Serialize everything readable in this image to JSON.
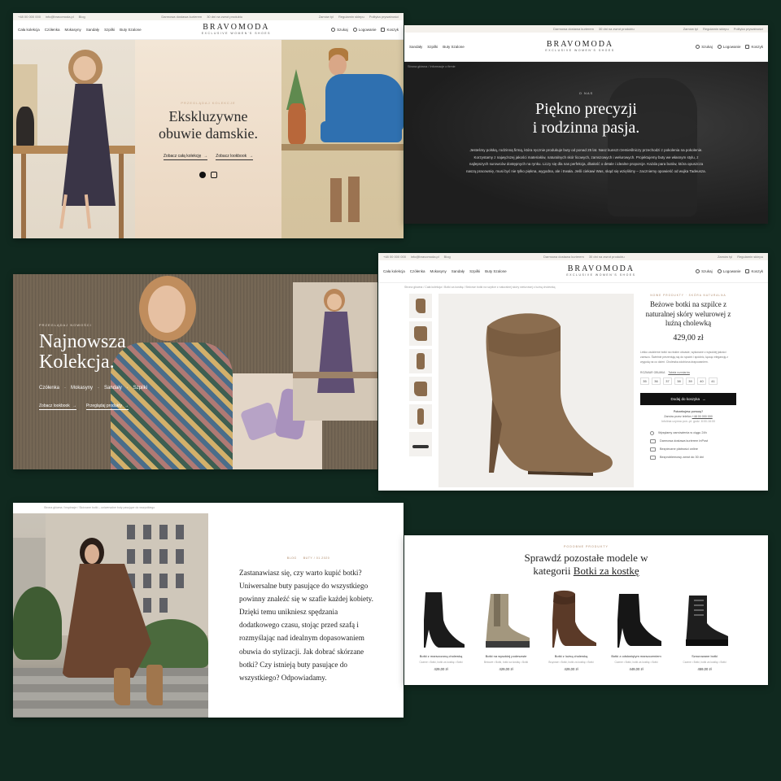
{
  "common": {
    "phone": "+48 00 000 000",
    "email": "info@bravomoda.pl",
    "blog": "Blog",
    "promo": "Darmowa dostawa kurierem",
    "promo_threshold": "30 dni na zwrot produktu",
    "account_links": [
      "Zamów tyl",
      "Regulamin sklepu",
      "Polityka prywatności"
    ],
    "nav": [
      "Cała kolekcja",
      "Czółenka",
      "Mokasyny",
      "Sandały",
      "Szpilki",
      "Buty Szalone"
    ],
    "brand": "BRAVOMODA",
    "brand_tag": "EXCLUSIVE WOMEN'S SHOES",
    "search": "Szukaj",
    "login": "Logowanie",
    "cart": "Koszyk"
  },
  "hero": {
    "eyebrow": "PRZEGLĄDAJ KOLEKCJE",
    "title_line1": "Ekskluzywne",
    "title_line2": "obuwie damskie.",
    "cta_collection": "Zobacz całą kolekcję",
    "cta_lookbook": "Zobacz lookbook"
  },
  "about": {
    "breadcrumb": "Strona główna / Informacje o firmie",
    "eyebrow": "O NAS",
    "title_line1": "Piękno precyzji",
    "title_line2": "i rodzinna pasja.",
    "paragraph": "Jesteśmy polską, rodzinną firmą, która ręcznie produkuje buty od ponad 25 lat. Nasz kunszt rzemieślniczy przechodzi z pokolenia na pokolenie. Korzystamy z najwyższej jakości materiałów, naturalnych skór licowych, zamszowych i welurowych. Projektujemy buty we własnym stylu, z najlepszych surowców dostępnych na rynku. Liczy się dla nas perfekcja, dbałość o detale i idealne proporcje. Każda para butów, która opuszcza naszą pracownię, musi być nie tylko piękna, wygodna, ale i trwała. Jeśli ciekawi Was, skąd się wzięliśmy – zaczniemy opowieść od wujka Tadeusza."
  },
  "collection": {
    "eyebrow": "PRZEGLĄDAJ NOWOŚCI",
    "title_line1": "Najnowsza",
    "title_line2": "Kolekcja.",
    "categories": [
      "Czółenka",
      "Mokasyny",
      "Sandały",
      "Szpilki"
    ],
    "cta_lookbook": "Zobacz lookbook",
    "cta_products": "Przeglądaj produkty"
  },
  "product": {
    "breadcrumb": "Strona główna / Cała kolekcja / Botki za kostkę / Beżowe botki na szpilce z naturalnej skóry welurowej z luźną cholewką",
    "eyebrow": "NOWE PRODUKTY  ·  SKÓRA NATURALNA",
    "title": "Beżowe botki na szpilce z naturalnej skóry welurowej z luźną cholewką",
    "price": "429,00 zł",
    "description": "Lekko zadzierne botki na niskim obcasie, wykonane z wysokiej jakości zamszu. Świetnie prezentują się do spodni i spódnic, łącząc elegancję z wygodą na co dzień. Cholewka zdobiona drapowaniem.",
    "size_label": "ROZMIAR OBUWIA",
    "size_table": "Tabela rozmiarów",
    "sizes": [
      "35",
      "36",
      "37",
      "38",
      "39",
      "40",
      "41"
    ],
    "add_to_cart": "Dodaj do koszyka",
    "help_title": "Potrzebujesz pomocy?",
    "help_text": "Zamów przez telefon",
    "help_phone": "+48 00 000 000",
    "help_hours": "Infolinia czynna pon.-pt. godz. 8:00-16:00",
    "benefits": [
      "Wysyłamy zamówienia w ciągu 24h",
      "Darmowa dostawa kurierem InPost",
      "Bezpieczne płatności online",
      "Bezproblemowy zwrot do 30 dni"
    ]
  },
  "blog": {
    "breadcrumb": "Strona główna / Inspiracje / Skórzane botki – uniwersalne buty pasujące do wszystkiego",
    "meta_category": "BLOG",
    "meta_date": "BUTY / 01.2020",
    "text": "Zastanawiasz się, czy warto kupić botki? Uniwersalne buty pasujące do wszystkiego powinny znaleźć się w szafie każdej kobiety. Dzięki temu unikniesz spędzania dodatkowego czasu, stojąc przed szafą i rozmyślając nad idealnym dopasowaniem obuwia do stylizacji. Jak dobrać skórzane botki? Czy istnieją buty pasujące do wszystkiego? Odpowiadamy."
  },
  "related": {
    "eyebrow": "PODOBNE PRODUKTY",
    "title_line1": "Sprawdź pozostałe modele w",
    "title_prefix": "kategorii",
    "title_link": "Botki za kostkę",
    "products": [
      {
        "name": "Botki z marszczoną cholewką",
        "meta": "Czarne • Botki, botki za kostkę • Botki",
        "price": "429,00 zł"
      },
      {
        "name": "Botki na wysokiej podeszwie",
        "meta": "Beżowe • Botki, botki za kostkę • Botki",
        "price": "429,00 zł"
      },
      {
        "name": "Botki z luźną cholewką",
        "meta": "Brązowe • Botki, botki za kostkę • Botki",
        "price": "429,00 zł"
      },
      {
        "name": "Botki z odsłoniętym marszczeniem",
        "meta": "Czarne • Botki, botki za kostkę • Botki",
        "price": "449,00 zł"
      },
      {
        "name": "Sznurowane botki",
        "meta": "Czarne • Botki, botki za kostkę • Botki",
        "price": "459,00 zł"
      }
    ]
  },
  "colors": {
    "background": "#10291f",
    "accent": "#b08a6a",
    "dark": "#111111"
  }
}
